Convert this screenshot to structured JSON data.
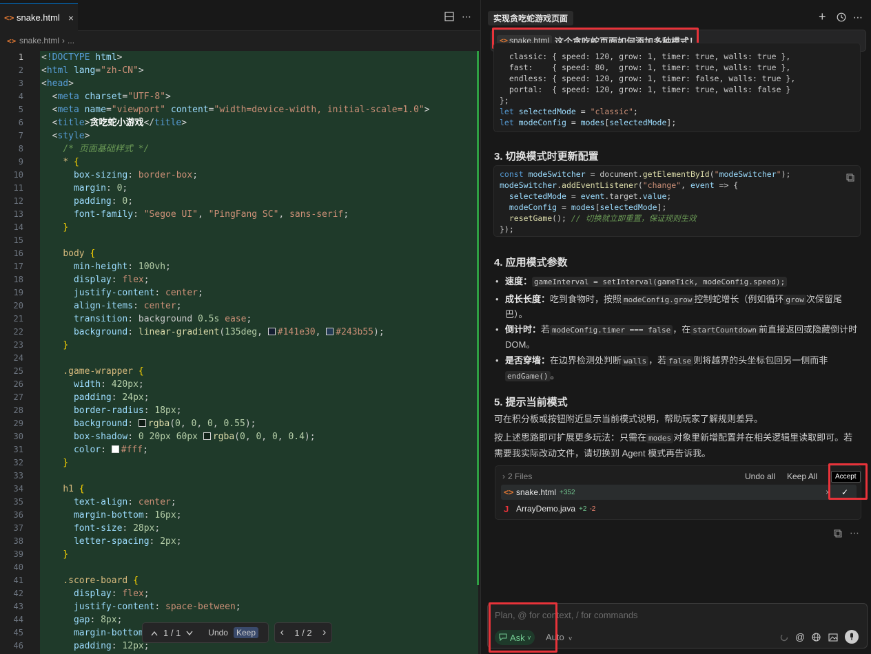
{
  "editor": {
    "tab_label": "snake.html",
    "tab_close": "×",
    "breadcrumb_file": "snake.html",
    "breadcrumb_sep": "›",
    "breadcrumb_more": "...",
    "lines": [
      {
        "n": "1",
        "html": "<span class='t-plain'>&lt;</span><span class='t-tag'>!DOCTYPE</span> <span class='t-attr'>html</span><span class='t-plain'>&gt;</span>"
      },
      {
        "n": "2",
        "html": "<span class='t-plain'>&lt;</span><span class='t-tag'>html</span> <span class='t-attr'>lang</span>=<span class='t-str'>\"zh-CN\"</span><span class='t-plain'>&gt;</span>"
      },
      {
        "n": "3",
        "html": "<span class='t-plain'>&lt;</span><span class='t-tag'>head</span><span class='t-plain'>&gt;</span>"
      },
      {
        "n": "4",
        "html": "  <span class='t-plain'>&lt;</span><span class='t-tag'>meta</span> <span class='t-attr'>charset</span>=<span class='t-str'>\"UTF-8\"</span><span class='t-plain'>&gt;</span>"
      },
      {
        "n": "5",
        "html": "  <span class='t-plain'>&lt;</span><span class='t-tag'>meta</span> <span class='t-attr'>name</span>=<span class='t-str'>\"viewport\"</span> <span class='t-attr'>content</span>=<span class='t-str'>\"width=device-width, initial-scale=1.0\"</span><span class='t-plain'>&gt;</span>"
      },
      {
        "n": "6",
        "html": "  <span class='t-plain'>&lt;</span><span class='t-tag'>title</span><span class='t-plain'>&gt;</span><span style='color:#fff;font-weight:bold'>贪吃蛇小游戏</span><span class='t-plain'>&lt;/</span><span class='t-tag'>title</span><span class='t-plain'>&gt;</span>"
      },
      {
        "n": "7",
        "html": "  <span class='t-plain'>&lt;</span><span class='t-tag'>style</span><span class='t-plain'>&gt;</span>"
      },
      {
        "n": "8",
        "html": "    <span class='t-com'>/* 页面基础样式 */</span>"
      },
      {
        "n": "9",
        "html": "    <span class='t-sel'>*</span> <span class='t-brace'>{</span>"
      },
      {
        "n": "10",
        "html": "      <span class='t-prop'>box-sizing</span>: <span class='t-kw'>border-box</span>;"
      },
      {
        "n": "11",
        "html": "      <span class='t-prop'>margin</span>: <span class='t-num'>0</span>;"
      },
      {
        "n": "12",
        "html": "      <span class='t-prop'>padding</span>: <span class='t-num'>0</span>;"
      },
      {
        "n": "13",
        "html": "      <span class='t-prop'>font-family</span>: <span class='t-str'>\"Segoe UI\"</span>, <span class='t-str'>\"PingFang SC\"</span>, <span class='t-kw'>sans-serif</span>;"
      },
      {
        "n": "14",
        "html": "    <span class='t-brace'>}</span>"
      },
      {
        "n": "15",
        "html": ""
      },
      {
        "n": "16",
        "html": "    <span class='t-sel'>body</span> <span class='t-brace'>{</span>"
      },
      {
        "n": "17",
        "html": "      <span class='t-prop'>min-height</span>: <span class='t-num'>100vh</span>;"
      },
      {
        "n": "18",
        "html": "      <span class='t-prop'>display</span>: <span class='t-kw'>flex</span>;"
      },
      {
        "n": "19",
        "html": "      <span class='t-prop'>justify-content</span>: <span class='t-kw'>center</span>;"
      },
      {
        "n": "20",
        "html": "      <span class='t-prop'>align-items</span>: <span class='t-kw'>center</span>;"
      },
      {
        "n": "21",
        "html": "      <span class='t-prop'>transition</span>: background <span class='t-num'>0.5s</span> <span class='t-kw'>ease</span>;"
      },
      {
        "n": "22",
        "html": "      <span class='t-prop'>background</span>: <span class='t-fn'>linear-gradient</span>(<span class='t-num'>135deg</span>, <span class='sw' style='background:#141e30'></span><span class='t-kw'>#141e30</span>, <span class='sw' style='background:#243b55'></span><span class='t-kw'>#243b55</span>);"
      },
      {
        "n": "23",
        "html": "    <span class='t-brace'>}</span>"
      },
      {
        "n": "24",
        "html": ""
      },
      {
        "n": "25",
        "html": "    <span class='t-sel'>.game-wrapper</span> <span class='t-brace'>{</span>"
      },
      {
        "n": "26",
        "html": "      <span class='t-prop'>width</span>: <span class='t-num'>420px</span>;"
      },
      {
        "n": "27",
        "html": "      <span class='t-prop'>padding</span>: <span class='t-num'>24px</span>;"
      },
      {
        "n": "28",
        "html": "      <span class='t-prop'>border-radius</span>: <span class='t-num'>18px</span>;"
      },
      {
        "n": "29",
        "html": "      <span class='t-prop'>background</span>: <span class='sw' style='background:rgba(0,0,0,0.55)'></span><span class='t-fn'>rgba</span>(<span class='t-num'>0</span>, <span class='t-num'>0</span>, <span class='t-num'>0</span>, <span class='t-num'>0.55</span>);"
      },
      {
        "n": "30",
        "html": "      <span class='t-prop'>box-shadow</span>: <span class='t-num'>0</span> <span class='t-num'>20px</span> <span class='t-num'>60px</span> <span class='sw' style='background:rgba(0,0,0,0.4)'></span><span class='t-fn'>rgba</span>(<span class='t-num'>0</span>, <span class='t-num'>0</span>, <span class='t-num'>0</span>, <span class='t-num'>0.4</span>);"
      },
      {
        "n": "31",
        "html": "      <span class='t-prop'>color</span>: <span class='sw' style='background:#fff'></span><span class='t-kw'>#fff</span>;"
      },
      {
        "n": "32",
        "html": "    <span class='t-brace'>}</span>"
      },
      {
        "n": "33",
        "html": ""
      },
      {
        "n": "34",
        "html": "    <span class='t-sel'>h1</span> <span class='t-brace'>{</span>"
      },
      {
        "n": "35",
        "html": "      <span class='t-prop'>text-align</span>: <span class='t-kw'>center</span>;"
      },
      {
        "n": "36",
        "html": "      <span class='t-prop'>margin-bottom</span>: <span class='t-num'>16px</span>;"
      },
      {
        "n": "37",
        "html": "      <span class='t-prop'>font-size</span>: <span class='t-num'>28px</span>;"
      },
      {
        "n": "38",
        "html": "      <span class='t-prop'>letter-spacing</span>: <span class='t-num'>2px</span>;"
      },
      {
        "n": "39",
        "html": "    <span class='t-brace'>}</span>"
      },
      {
        "n": "40",
        "html": ""
      },
      {
        "n": "41",
        "html": "    <span class='t-sel'>.score-board</span> <span class='t-brace'>{</span>"
      },
      {
        "n": "42",
        "html": "      <span class='t-prop'>display</span>: <span class='t-kw'>flex</span>;"
      },
      {
        "n": "43",
        "html": "      <span class='t-prop'>justify-content</span>: <span class='t-kw'>space-between</span>;"
      },
      {
        "n": "44",
        "html": "      <span class='t-prop'>gap</span>: <span class='t-num'>8px</span>;"
      },
      {
        "n": "45",
        "html": "      <span class='t-prop'>margin-bottom</span>"
      },
      {
        "n": "46",
        "html": "      <span class='t-prop'>padding</span>: <span class='t-num'>12px</span>;"
      }
    ],
    "diff_nav": {
      "up": "^",
      "count": "1 / 1",
      "down": "v",
      "undo": "Undo",
      "keep": "Keep"
    },
    "file_nav": {
      "prev": "‹",
      "count": "1 / 2",
      "next": "›"
    }
  },
  "chat": {
    "title": "实现贪吃蛇游戏页面",
    "user_chip": "snake.html",
    "user_text": "这个贪吃蛇页面如何添加多种模式！",
    "code1": [
      "  classic: { speed: 120, grow: 1, timer: true, walls: true },",
      "  fast:    { speed: 80,  grow: 1, timer: true, walls: true },",
      "  endless: { speed: 120, grow: 1, timer: false, walls: true },",
      "  portal:  { speed: 120, grow: 1, timer: true, walls: false }",
      "};",
      "let selectedMode = \"classic\";",
      "let modeConfig = modes[selectedMode];"
    ],
    "h3_3": "3. 切换模式时更新配置",
    "code2": [
      "const modeSwitcher = document.getElementById(\"modeSwitcher\");",
      "modeSwitcher.addEventListener(\"change\", event => {",
      "  selectedMode = event.target.value;",
      "  modeConfig = modes[selectedMode];",
      "  resetGame(); // 切换就立即重置，保证规则生效",
      "});"
    ],
    "h3_4": "4. 应用模式参数",
    "bullet1_label": "速度：",
    "bullet1_code": "gameInterval = setInterval(gameTick, modeConfig.speed);",
    "bullet2_label": "成长长度：",
    "bullet2_a": "吃到食物时，按照",
    "bullet2_code1": "modeConfig.grow",
    "bullet2_b": "控制蛇增长（例如循环",
    "bullet2_code2": "grow",
    "bullet2_c": "次保留尾巴）。",
    "bullet3_label": "倒计时：",
    "bullet3_a": "若",
    "bullet3_code1": "modeConfig.timer === false",
    "bullet3_b": "，在",
    "bullet3_code2": "startCountdown",
    "bullet3_c": "前直接返回或隐藏倒计时 DOM。",
    "bullet4_label": "是否穿墙：",
    "bullet4_a": "在边界检测处判断",
    "bullet4_code1": "walls",
    "bullet4_b": "，若",
    "bullet4_code2": "false",
    "bullet4_c": "则将越界的头坐标包回另一侧而非",
    "bullet4_code3": "endGame()",
    "bullet4_d": "。",
    "h3_5": "5. 提示当前模式",
    "para1": "可在积分板或按钮附近显示当前模式说明，帮助玩家了解规则差异。",
    "para2_a": "按上述思路即可扩展更多玩法：只需在",
    "para2_code": "modes",
    "para2_b": "对象里新增配置并在相关逻辑里读取即可。若需要我实际改动文件，请切换到 Agent 模式再告诉我。",
    "files": {
      "head": "2 Files",
      "undo_all": "Undo all",
      "keep_all": "Keep All",
      "accept_tip": "Accept",
      "rows": [
        {
          "name": "snake.html",
          "plus": "+352",
          "minus": ""
        },
        {
          "name": "ArrayDemo.java",
          "plus": "+2",
          "minus": "-2"
        }
      ]
    },
    "input_placeholder": "Plan, @ for context, / for commands",
    "ask_label": "Ask",
    "auto_label": "Auto"
  }
}
